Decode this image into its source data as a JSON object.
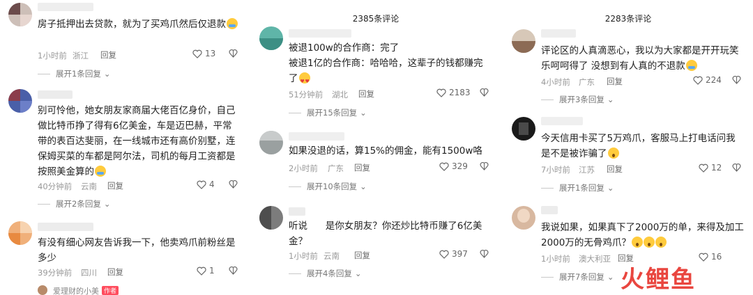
{
  "colors": {
    "watermark": "#e9463f",
    "author_badge": "#ff4d5e",
    "meta": "#999999"
  },
  "icons": {
    "like": "heart-outline-icon",
    "dislike": "thumb-down-icon",
    "expand": "chevron-down-icon"
  },
  "panel1": {
    "comments": [
      {
        "text": "房子抵押出去贷款，就为了买鸡爪然后仅退款",
        "time": "1小时前",
        "location": "浙江",
        "reply": "回复",
        "likes": "13",
        "expand": "展开1条回复"
      },
      {
        "text": "别可怜他，她女朋友家商届大佬百亿身价，自己做比特币挣了得有6亿美金，车是迈巴赫，平常带的表百达斐丽，在一线城市还有高价别墅，连保姆买菜的车都是阿尔法，司机的每月工资都是按照美金算的",
        "time": "40分钟前",
        "location": "云南",
        "reply": "回复",
        "likes": "4",
        "expand": "展开2条回复"
      },
      {
        "text": "有没有细心网友告诉我一下，他卖鸡爪前粉丝是多少",
        "time": "39分钟前",
        "location": "四川",
        "reply": "回复",
        "likes": "1"
      }
    ],
    "author_row": {
      "name": "爱理财的小美",
      "badge": "作者"
    }
  },
  "panel2": {
    "count": "2385条评论",
    "comments": [
      {
        "text": "被退100w的合作商：完了\n被退1亿的合作商：哈哈哈，这辈子的钱都赚完了",
        "time": "51分钟前",
        "location": "湖北",
        "reply": "回复",
        "likes": "2183",
        "expand": "展开15条回复"
      },
      {
        "text": "如果没退的话，算15%的佣金，能有1500w咯",
        "time": "2小时前",
        "location": "广东",
        "reply": "回复",
        "likes": "329",
        "expand": "展开10条回复"
      },
      {
        "text": "听说      是你女朋友？你还炒比特币赚了6亿美金？",
        "time": "1小时前",
        "location": "云南",
        "reply": "回复",
        "likes": "397",
        "expand": "展开4条回复"
      }
    ]
  },
  "panel3": {
    "count": "2283条评论",
    "comments": [
      {
        "text": "评论区的人真滴恶心，我以为大家都是开开玩笑乐呵呵得了 没想到有人真的不退款",
        "time": "4小时前",
        "location": "广东",
        "reply": "回复",
        "likes": "224",
        "expand": "展开3条回复"
      },
      {
        "text": "今天信用卡买了5万鸡爪，客服马上打电话问我是不是被诈骗了",
        "time": "7小时前",
        "location": "江苏",
        "reply": "回复",
        "likes": "12",
        "expand": "展开1条回复"
      },
      {
        "text": "我说如果，如果真下了2000万的单，来得及加工2000万的无骨鸡爪？",
        "time": "1小时前",
        "location": "澳大利亚",
        "reply": "回复",
        "likes": "16",
        "expand": "展开7条回复"
      }
    ]
  },
  "watermark": "火鲤鱼"
}
